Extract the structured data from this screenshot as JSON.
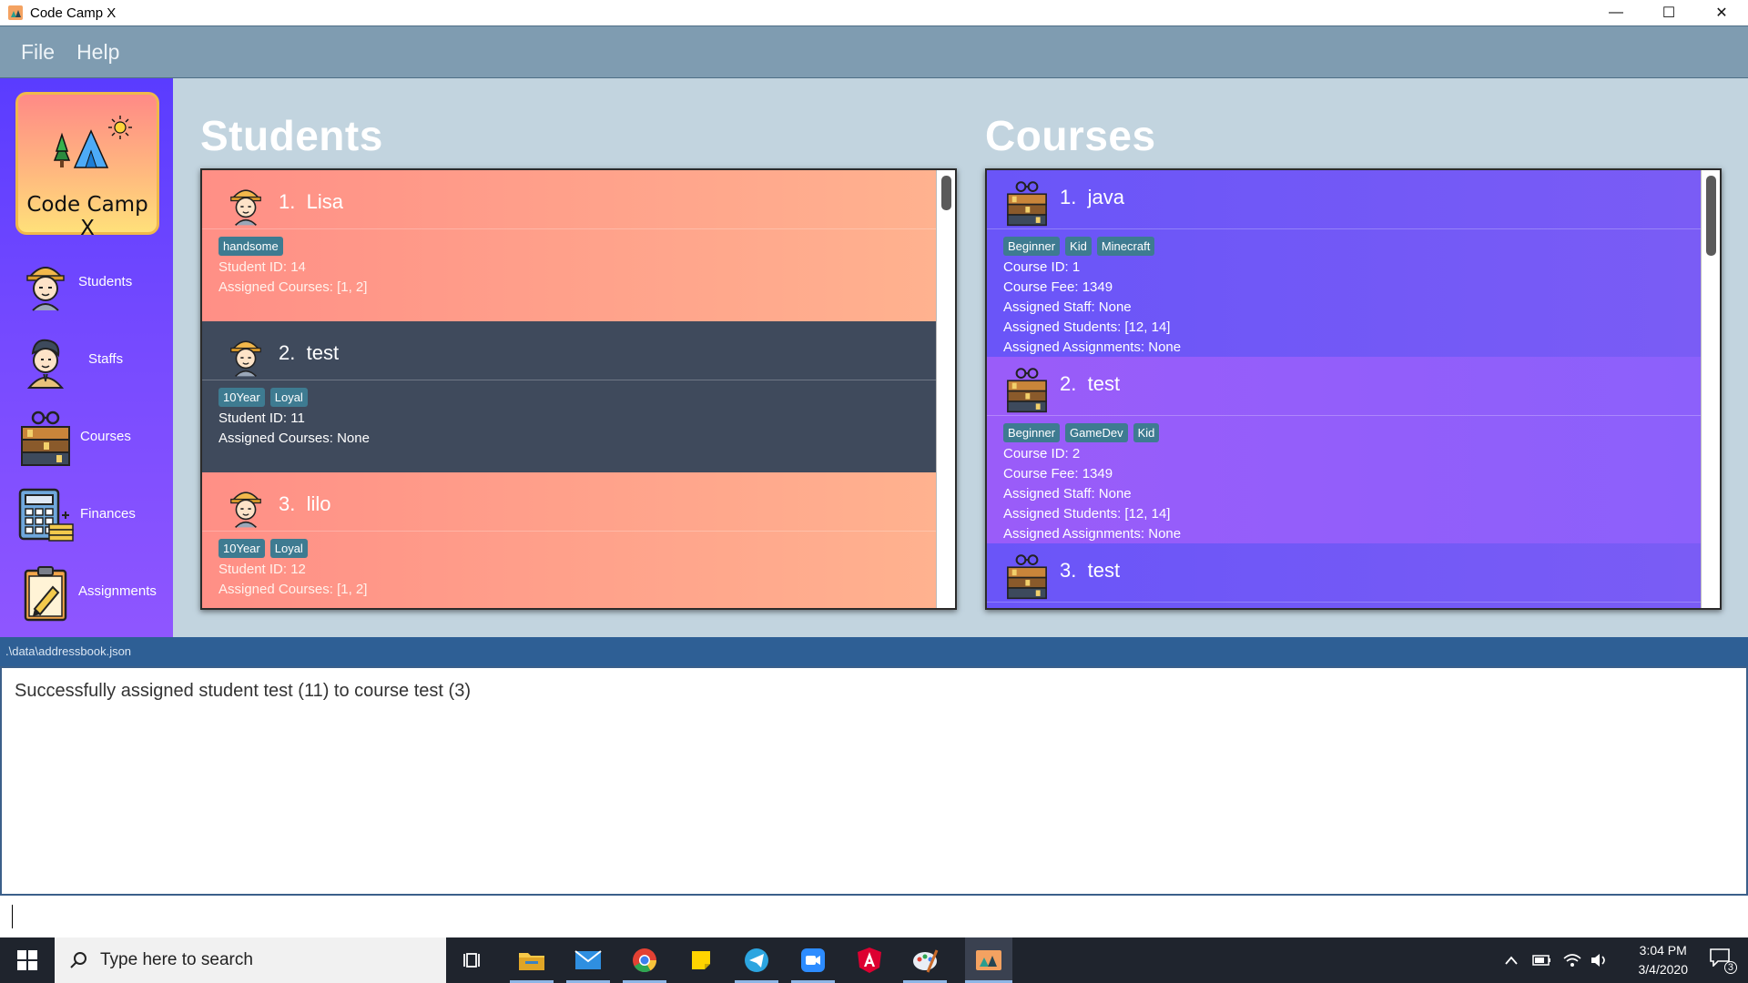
{
  "window": {
    "title": "Code Camp X",
    "minimize": "—",
    "maximize": "☐",
    "close": "✕"
  },
  "menu": [
    "File",
    "Help"
  ],
  "logo": {
    "text": "Code Camp X"
  },
  "sidebar": [
    {
      "label": "Students",
      "icon": "student-icon"
    },
    {
      "label": "Staffs",
      "icon": "staff-icon"
    },
    {
      "label": "Courses",
      "icon": "courses-icon"
    },
    {
      "label": "Finances",
      "icon": "calculator-icon"
    },
    {
      "label": "Assignments",
      "icon": "clipboard-icon"
    }
  ],
  "students_panel": {
    "title": "Students",
    "items": [
      {
        "index": "1.",
        "name": "Lisa",
        "tags": [
          "handsome"
        ],
        "lines": [
          "Student ID: 14",
          "Assigned Courses: [1, 2]"
        ]
      },
      {
        "index": "2.",
        "name": "test",
        "tags": [
          "10Year",
          "Loyal"
        ],
        "lines": [
          "Student ID: 11",
          "Assigned Courses: None"
        ]
      },
      {
        "index": "3.",
        "name": "lilo",
        "tags": [
          "10Year",
          "Loyal"
        ],
        "lines": [
          "Student ID: 12",
          "Assigned Courses: [1, 2]"
        ]
      }
    ]
  },
  "courses_panel": {
    "title": "Courses",
    "items": [
      {
        "index": "1.",
        "name": "java",
        "tags": [
          "Beginner",
          "Kid",
          "Minecraft"
        ],
        "lines": [
          "Course ID: 1",
          "Course Fee: 1349",
          "Assigned Staff: None",
          "Assigned Students: [12, 14]",
          "Assigned Assignments: None"
        ]
      },
      {
        "index": "2.",
        "name": "test",
        "tags": [
          "Beginner",
          "GameDev",
          "Kid"
        ],
        "lines": [
          "Course ID: 2",
          "Course Fee: 1349",
          "Assigned Staff: None",
          "Assigned Students: [12, 14]",
          "Assigned Assignments: None"
        ]
      },
      {
        "index": "3.",
        "name": "test",
        "tags": [],
        "lines": []
      }
    ]
  },
  "status_bar": {
    "path": ".\\data\\addressbook.json"
  },
  "result": {
    "text": "Successfully assigned student test (11) to course test (3)"
  },
  "command": {
    "value": ""
  },
  "taskbar": {
    "search_placeholder": "Type here to search",
    "time": "3:04 PM",
    "date": "3/4/2020",
    "notification_count": "3"
  }
}
